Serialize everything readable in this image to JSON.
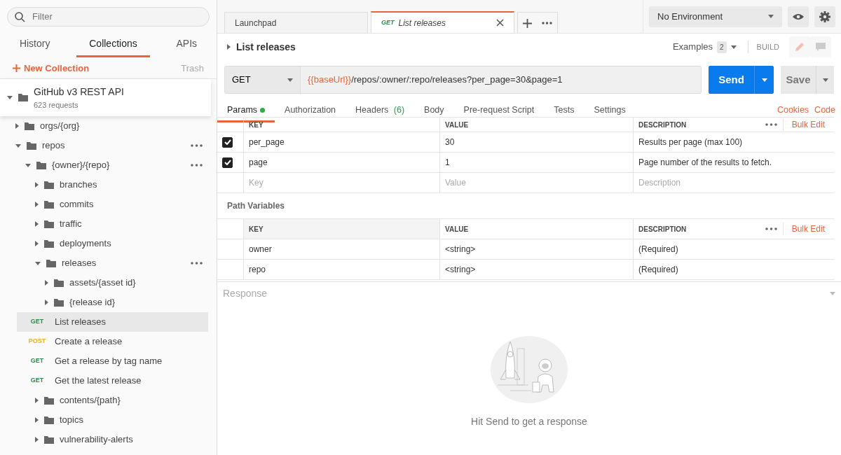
{
  "sidebar": {
    "filter": {
      "placeholder": "Filter"
    },
    "tabs": [
      {
        "label": "History",
        "selected": false
      },
      {
        "label": "Collections",
        "selected": true
      },
      {
        "label": "APIs",
        "selected": false
      }
    ],
    "new_collection": "New Collection",
    "trash": "Trash",
    "collection": {
      "name": "GitHub v3 REST API",
      "count": "623 requests",
      "expanded": true
    },
    "tree": [
      {
        "kind": "folder",
        "name": "orgs/{org}",
        "expanded": false,
        "more_menu": false
      },
      {
        "kind": "folder",
        "name": "repos",
        "expanded": true,
        "more_menu": true,
        "children": [
          {
            "kind": "folder",
            "name": "{owner}/{repo}",
            "expanded": true,
            "more_menu": true,
            "children": [
              {
                "kind": "folder",
                "name": "branches",
                "expanded": false,
                "more_menu": false
              },
              {
                "kind": "folder",
                "name": "commits",
                "expanded": false,
                "more_menu": false
              },
              {
                "kind": "folder",
                "name": "traffic",
                "expanded": false,
                "more_menu": false
              },
              {
                "kind": "folder",
                "name": "deployments",
                "expanded": false,
                "more_menu": false
              },
              {
                "kind": "folder",
                "name": "releases",
                "expanded": true,
                "more_menu": true,
                "children": [
                  {
                    "kind": "folder",
                    "name": "assets/{asset id}",
                    "expanded": false,
                    "more_menu": false
                  },
                  {
                    "kind": "folder",
                    "name": "{release id}",
                    "expanded": false,
                    "more_menu": false
                  },
                  {
                    "kind": "request",
                    "method": "GET",
                    "color": "#2a8a4a",
                    "name": "List releases",
                    "selected": true
                  },
                  {
                    "kind": "request",
                    "method": "POST",
                    "color": "#e8b21c",
                    "name": "Create a release",
                    "selected": false
                  },
                  {
                    "kind": "request",
                    "method": "GET",
                    "color": "#2a8a4a",
                    "name": "Get a release by tag name",
                    "selected": false
                  },
                  {
                    "kind": "request",
                    "method": "GET",
                    "color": "#2a8a4a",
                    "name": "Get the latest release",
                    "selected": false
                  }
                ]
              },
              {
                "kind": "folder",
                "name": "contents/{path}",
                "expanded": false,
                "more_menu": false
              },
              {
                "kind": "folder",
                "name": "topics",
                "expanded": false,
                "more_menu": false
              },
              {
                "kind": "folder",
                "name": "vulnerability-alerts",
                "expanded": false,
                "more_menu": false
              }
            ]
          }
        ]
      }
    ]
  },
  "request_tabs": [
    {
      "label": "Launchpad",
      "selected": false
    },
    {
      "method": "GET",
      "label": "List releases",
      "selected": true
    }
  ],
  "environment": "No Environment",
  "request": {
    "title": "List releases",
    "expanded": false,
    "examples": "Examples",
    "examples_count": "2",
    "build": "BUILD",
    "method": "GET",
    "url_variable": "{{baseUrl}}",
    "url_path": "/repos/:owner/:repo/releases?per_page=30&page=1",
    "send": "Send",
    "save": "Save"
  },
  "sub_tabs": [
    {
      "label": "Params",
      "indicator": true,
      "selected": true
    },
    {
      "label": "Authorization",
      "selected": false
    },
    {
      "label": "Headers",
      "count": "(6)",
      "selected": false
    },
    {
      "label": "Body",
      "selected": false
    },
    {
      "label": "Pre-request Script",
      "selected": false
    },
    {
      "label": "Tests",
      "selected": false
    },
    {
      "label": "Settings",
      "selected": false
    }
  ],
  "links": [
    "Cookies",
    "Code"
  ],
  "params": {
    "columns": [
      "KEY",
      "VALUE",
      "DESCRIPTION"
    ],
    "bulk_edit": "Bulk Edit",
    "rows": [
      {
        "key": "per_page",
        "value": "30",
        "description": "Results per page (max 100)",
        "checked": true
      },
      {
        "key": "page",
        "value": "1",
        "description": "Page number of the results to fetch.",
        "checked": true
      }
    ],
    "new_row": {
      "key": {
        "placeholder": "Key"
      },
      "value": {
        "placeholder": "Value"
      },
      "description": {
        "placeholder": "Description"
      }
    }
  },
  "path_variables": {
    "title": "Path Variables",
    "columns": [
      "KEY",
      "VALUE",
      "DESCRIPTION"
    ],
    "bulk_edit": "Bulk Edit",
    "rows": [
      {
        "key": "owner",
        "value": "<string>",
        "description": "(Required)"
      },
      {
        "key": "repo",
        "value": "<string>",
        "description": "(Required)"
      }
    ]
  },
  "response": {
    "title": "Response",
    "message": "Hit Send to get a response"
  }
}
